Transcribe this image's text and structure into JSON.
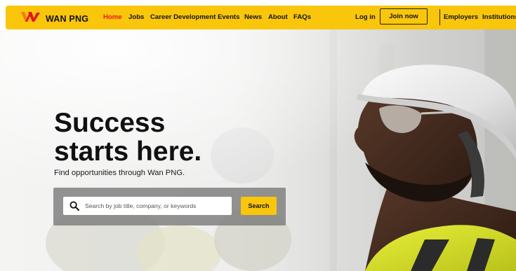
{
  "brand": {
    "name": "WAN PNG",
    "logo_icon": "wan-png-logo-icon",
    "accent_color": "#f9c60b",
    "logo_red": "#e5151c",
    "logo_orange": "#f27b11"
  },
  "nav": {
    "links": [
      {
        "label": "Home",
        "active": true
      },
      {
        "label": "Jobs"
      },
      {
        "label": "Career Development"
      },
      {
        "label": "Events"
      },
      {
        "label": "News"
      },
      {
        "label": "About"
      },
      {
        "label": "FAQs"
      }
    ],
    "login_label": "Log in",
    "join_label": "Join now",
    "employers_label": "Employers",
    "institutions_label": "Institutions"
  },
  "hero": {
    "headline_line1": "Success",
    "headline_line2": "starts here.",
    "subtext": "Find opportunities through Wan PNG.",
    "search": {
      "placeholder": "Search by job title, company, or keywords",
      "value": "",
      "icon": "search-icon",
      "button_label": "Search"
    },
    "image": "photo of worker in white hard hat, safety glasses and hi-vis vest looking up"
  }
}
